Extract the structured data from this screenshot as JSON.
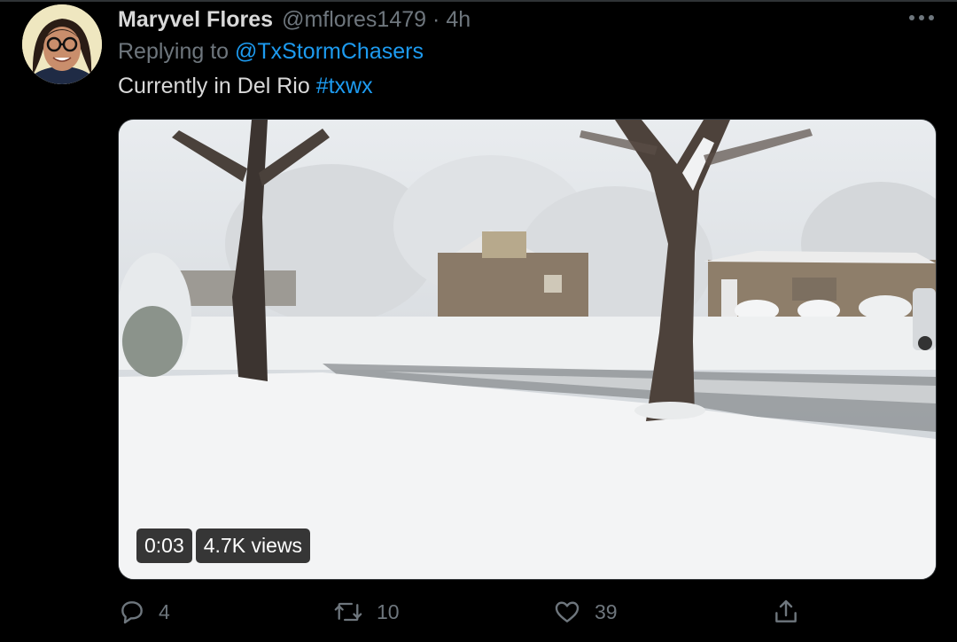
{
  "tweet": {
    "author_name": "Maryvel Flores",
    "handle": "@mflores1479",
    "separator": "·",
    "time": "4h",
    "replying_prefix": "Replying to",
    "replying_to": "@TxStormChasers",
    "text": "Currently in Del Rio",
    "hashtag": "#txwx"
  },
  "media": {
    "duration": "0:03",
    "views": "4.7K views",
    "description": "snowy residential street"
  },
  "actions": {
    "reply_count": "4",
    "retweet_count": "10",
    "like_count": "39"
  },
  "icons": {
    "more": "more-icon",
    "reply": "reply-icon",
    "retweet": "retweet-icon",
    "like": "like-icon",
    "share": "share-icon"
  },
  "colors": {
    "background": "#000000",
    "text": "#d9d9d9",
    "muted": "#6e767d",
    "accent": "#1d9bf0"
  }
}
